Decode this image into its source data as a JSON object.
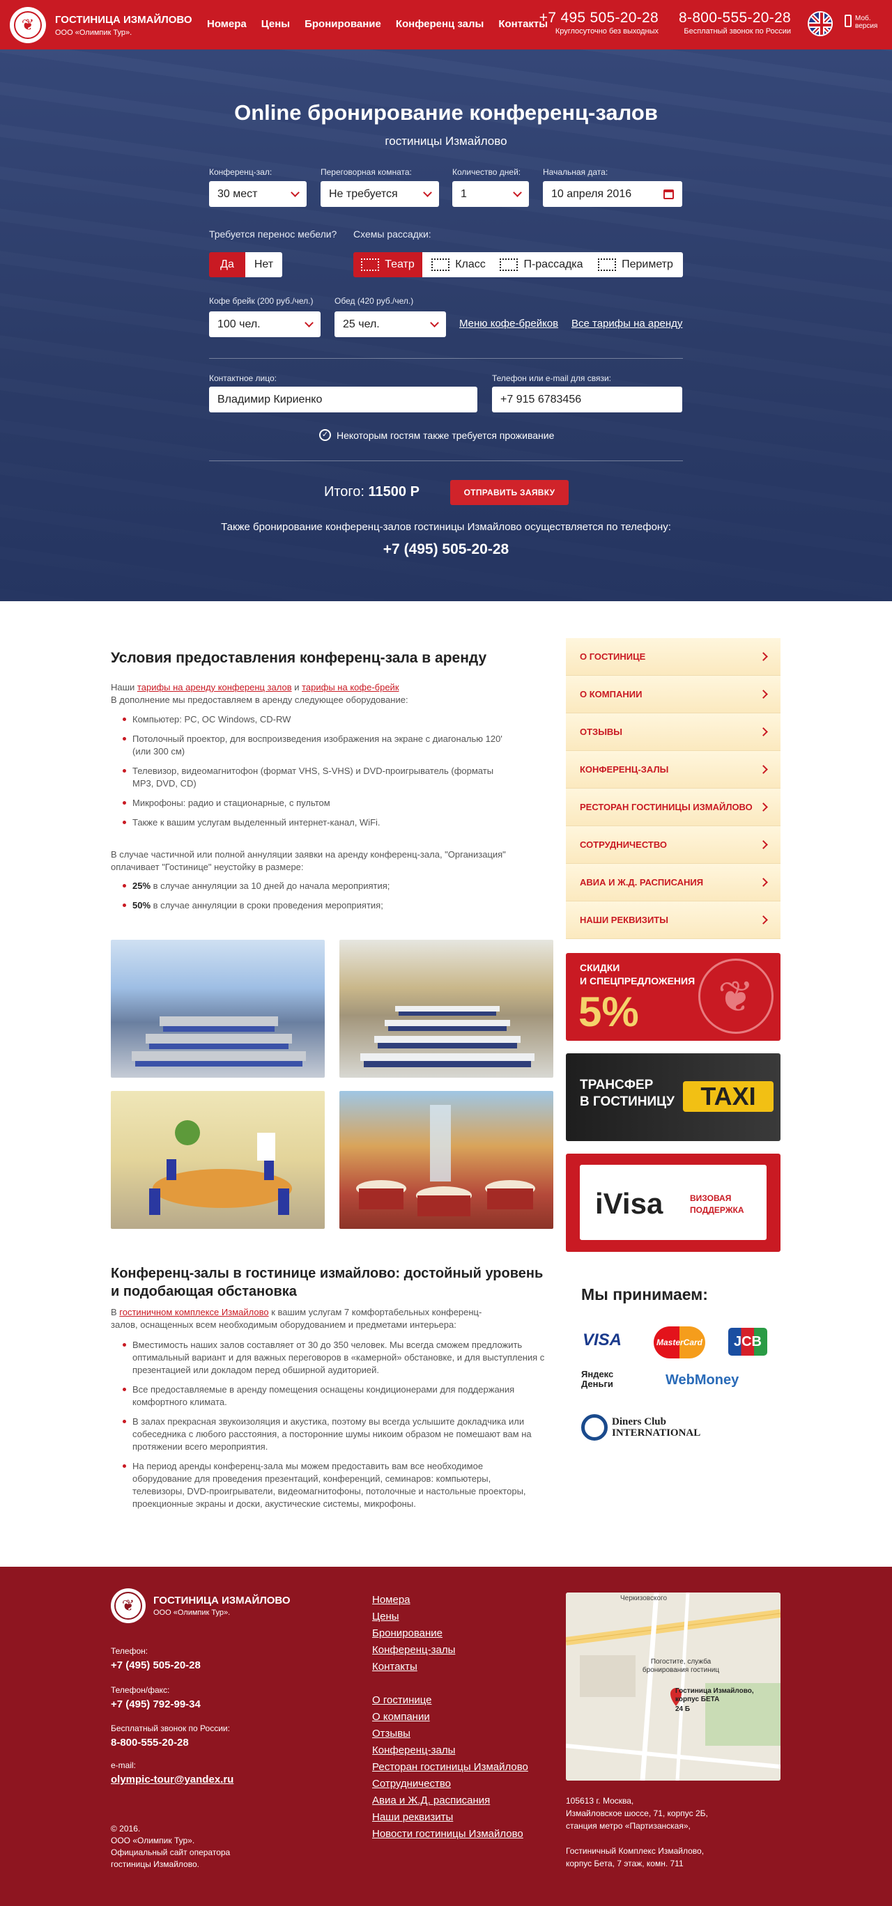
{
  "header": {
    "brand": "ГОСТИНИЦА ИЗМАЙЛОВО",
    "brand_sub": "ООО «Олимпик Тур».",
    "nav": [
      "Номера",
      "Цены",
      "Бронирование",
      "Конференц залы",
      "Контакты"
    ],
    "phone1": "+7 495 505-20-28",
    "phone1_note": "Круглосуточно без выходных",
    "phone2": "8-800-555-20-28",
    "phone2_note": "Бесплатный звонок по России",
    "mobile": "Моб. версия"
  },
  "form": {
    "title": "Online бронирование конференц-залов",
    "subtitle": "гостиницы Измайлово",
    "hall_label": "Конференц-зал:",
    "hall_value": "30 мест",
    "room_label": "Переговорная комната:",
    "room_value": "Не требуется",
    "days_label": "Количество дней:",
    "days_value": "1",
    "date_label": "Начальная дата:",
    "date_value": "10 апреля 2016",
    "furniture_label": "Требуется перенос мебели?",
    "yes": "Да",
    "no": "Нет",
    "schemes_label": "Схемы рассадки:",
    "schemes": [
      "Театр",
      "Класс",
      "П-рассадка",
      "Периметр"
    ],
    "coffee_label": "Кофе брейк (200 руб./чел.)",
    "coffee_value": "100 чел.",
    "lunch_label": "Обед (420 руб./чел.)",
    "lunch_value": "25 чел.",
    "link_menu": "Меню кофе-брейков",
    "link_tariffs": "Все тарифы на аренду",
    "contact_label": "Контактное лицо:",
    "contact_value": "Владимир Кириенко",
    "phone_label": "Телефон или e-mail для связи:",
    "phone_value": "+7 915 6783456",
    "accommodation": "Некоторым гостям также требуется проживание",
    "total_label": "Итого:",
    "total_value": "11500 Р",
    "send": "ОТПРАВИТЬ ЗАЯВКУ",
    "phone_note": "Также бронирование конференц-залов гостиницы Измайлово осуществляется по телефону:",
    "phone_big": "+7 (495) 505-20-28"
  },
  "conditions": {
    "title": "Условия предоставления конференц-зала в аренду",
    "intro_a": "Наши ",
    "link1": "тарифы на аренду конференц залов",
    "intro_b": " и ",
    "link2": "тарифы на кофе-брейк",
    "intro_c": "В дополнение мы предоставляем в аренду следующее оборудование:",
    "items": [
      "Компьютер: PC, OC Windows, CD-RW",
      "Потолочный проектор, для воспроизведения изображения на экране с диагональю 120' (или 300 см)",
      "Телевизор, видеомагнитофон (формат VHS, S-VHS) и DVD-проигрыватель (форматы MP3, DVD, CD)",
      "Микрофоны: радио и стационарные, с пультом",
      "Также к вашим услугам выделенный интернет-канал, WiFi."
    ],
    "cancel": "В случае частичной или полной аннуляции заявки на аренду конференц-зала, \"Организация\" оплачивает \"Гостинице\" неустойку в размере:",
    "p1_b": "25%",
    "p1": " в случае аннуляции за 10 дней до начала мероприятия;",
    "p2_b": "50%",
    "p2": " в случае аннуляции в сроки проведения мероприятия;"
  },
  "halls": {
    "title1": "Конференц-залы в гостинице измайлово: достойный уровень",
    "title2": "и подобающая обстановка",
    "intro_a": "В ",
    "link": "гостиничном комплексе Измайлово",
    "intro_b": " к вашим услугам 7 комфортабельных конференц-залов, оснащенных всем необходимым оборудованием и предметами интерьера:",
    "items": [
      "Вместимость наших залов составляет от 30 до 350 человек. Мы всегда сможем предложить оптимальный вариант и для важных переговоров в «камерной» обстановке, и для выступления с презентацией или докладом перед обширной аудиторией.",
      "Все предоставляемые в аренду помещения оснащены кондиционерами для поддержания комфортного климата.",
      "В залах прекрасная звукоизоляция и акустика, поэтому вы всегда услышите докладчика или собеседника с любого расстояния, а посторонние шумы никоим образом не помешают вам на протяжении всего мероприятия.",
      "На период аренды конференц-зала мы можем предоставить вам все необходимое оборудование для проведения презентаций, конференций, семинаров: компьютеры, телевизоры, DVD-проигрыватели, видеомагнитофоны, потолочные и настольные проекторы, проекционные экраны и доски, акустические системы, микрофоны."
    ]
  },
  "sidebar": {
    "menu": [
      "О ГОСТИНИЦЕ",
      "О КОМПАНИИ",
      "ОТЗЫВЫ",
      "КОНФЕРЕНЦ-ЗАЛЫ",
      "РЕСТОРАН ГОСТИНИЦЫ ИЗМАЙЛОВО",
      "СОТРУДНИЧЕСТВО",
      "АВИА И Ж.Д. РАСПИСАНИЯ",
      "НАШИ РЕКВИЗИТЫ"
    ],
    "banner1_a": "СКИДКИ",
    "banner1_b": "И СПЕЦПРЕДЛОЖЕНИЯ",
    "banner1_c": "5%",
    "banner2_a": "ТРАНСФЕР",
    "banner2_b": "В ГОСТИНИЦУ",
    "banner2_c": "TAXI",
    "banner3_logo": "iVisa",
    "banner3_a": "ВИЗОВАЯ",
    "banner3_b": "ПОДДЕРЖКА",
    "pay_title": "Мы принимаем:",
    "pay": [
      "VISA",
      "MasterCard",
      "JCB",
      "Яндекс Деньги",
      "WebMoney",
      "Diners Club INTERNATIONAL"
    ]
  },
  "footer": {
    "brand": "ГОСТИНИЦА ИЗМАЙЛОВО",
    "brand_sub": "ООО «Олимпик Тур».",
    "tel_l": "Телефон:",
    "tel": "+7 (495) 505-20-28",
    "fax_l": "Телефон/факс:",
    "fax": "+7 (495) 792-99-34",
    "free_l": "Бесплатный звонок по России:",
    "free": "8-800-555-20-28",
    "mail_l": "e-mail:",
    "mail": "olympic-tour@yandex.ru",
    "copy1": "© 2016.",
    "copy2": "ООО «Олимпик Тур».",
    "copy3": "Официальный сайт оператора",
    "copy4": "гостиницы Измайлово.",
    "nav1": [
      "Номера",
      "Цены",
      "Бронирование",
      "Конференц-залы",
      "Контакты"
    ],
    "nav2": [
      "О гостинице",
      "О компании",
      "Отзывы",
      "Конференц-залы",
      "Ресторан гостиницы Измайлово",
      "Сотрудничество",
      "Авиа и Ж.Д. расписания",
      "Наши реквизиты",
      "Новости гостиницы Измайлово"
    ],
    "map_a": "Черкизовского",
    "map_b": "Погостите, служба бронирования гостиниц",
    "map_pin": "Гостиница Измайлово, корпус БЕТА",
    "map_pin2": "24 Б",
    "addr1": "105613 г. Москва,",
    "addr2": "Измайловское шоссе, 71, корпус 2Б,",
    "addr3": "станция метро «Партизанская»,",
    "addr4": "Гостиничный Комплекс Измайлово,",
    "addr5": "корпус Бета, 7 этаж, комн. 711"
  }
}
